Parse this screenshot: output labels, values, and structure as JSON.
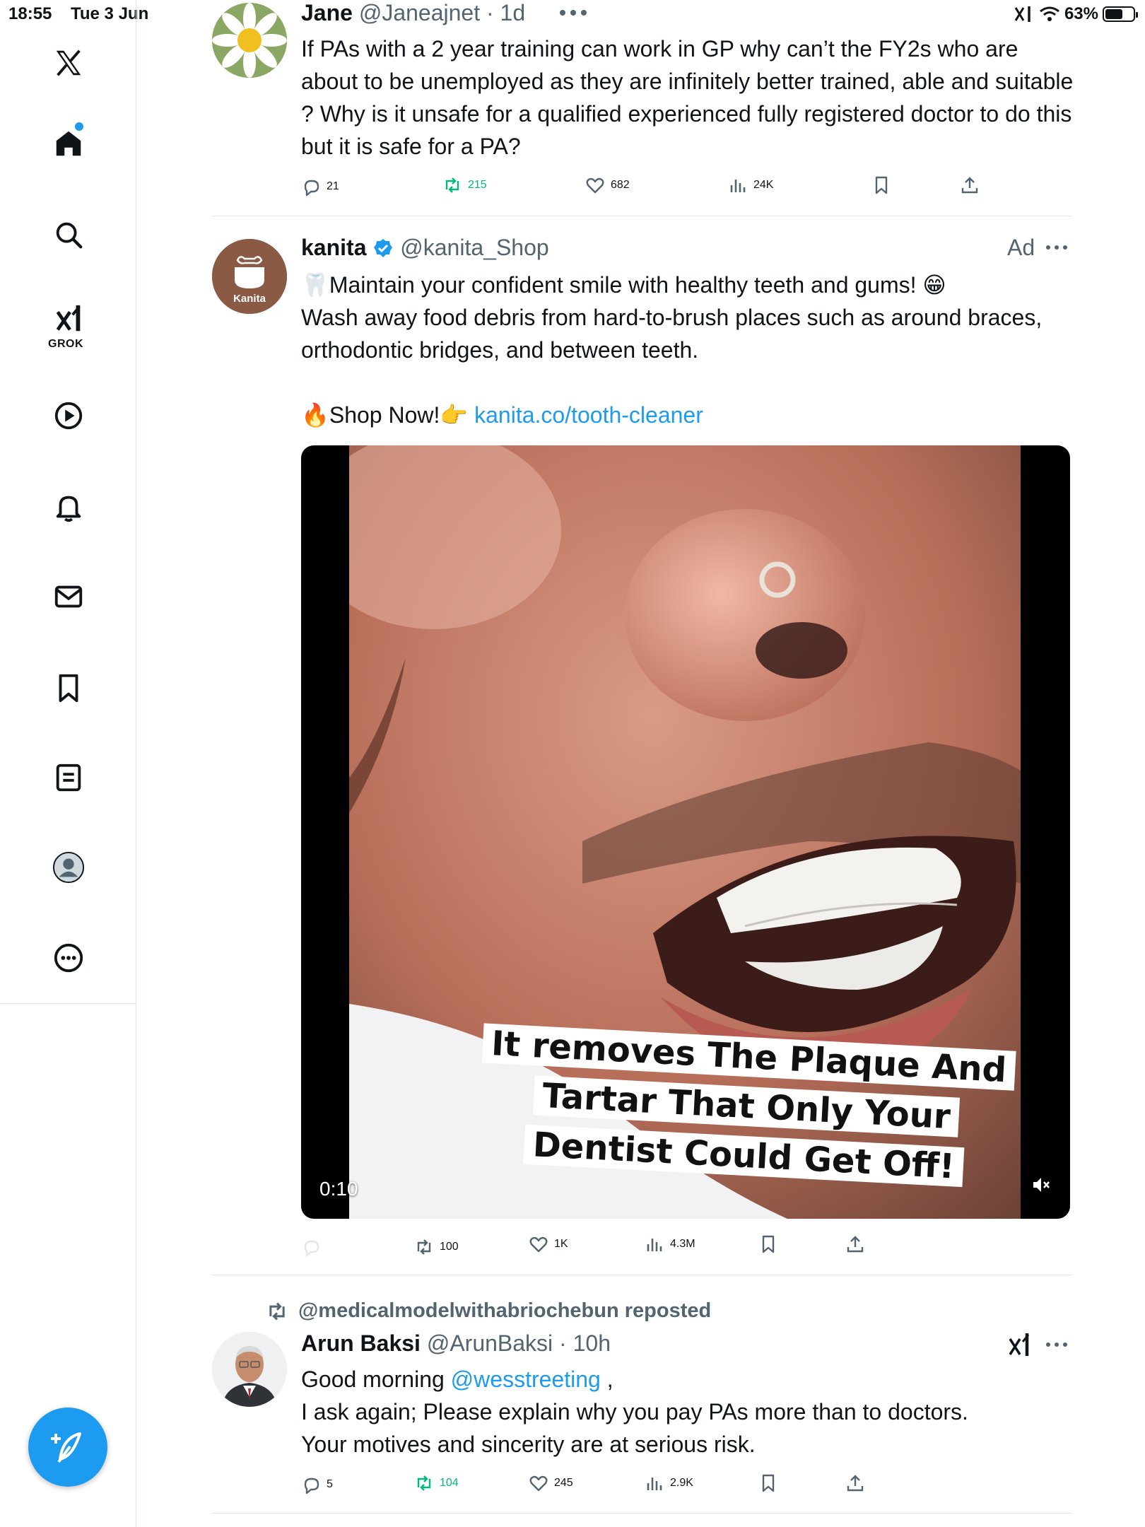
{
  "status_bar": {
    "time": "18:55",
    "date": "Tue 3 Jun",
    "battery": "63%",
    "battery_level": 0.63
  },
  "sidebar": {
    "grok_label": "GROK",
    "icons": [
      "x-logo-icon",
      "home-icon",
      "search-icon",
      "grok-icon",
      "video-icon",
      "notifications-icon",
      "messages-icon",
      "bookmarks-icon",
      "lists-icon",
      "profile-icon",
      "more-icon"
    ]
  },
  "posts": [
    {
      "name": "Jane",
      "handle": "@Janeajnet",
      "time": "· 1d",
      "body": "If PAs with a 2 year training can work in GP why can’t the FY2s who are about to be unemployed as they are infinitely better trained, able and suitable ? Why is it unsafe for a qualified experienced fully registered doctor to do this but it is safe for a PA?",
      "replies": "21",
      "reposts": "215",
      "likes": "682",
      "views": "24K"
    },
    {
      "name": "kanita",
      "handle": "@kanita_Shop",
      "ad_label": "Ad",
      "avatar_text": "Kanita",
      "line1": "🦷Maintain your confident smile with healthy teeth and gums! 😁",
      "line2": "Wash away food debris from hard-to-brush places such as around braces, orthodontic bridges, and between teeth.",
      "shop_text": "🔥Shop Now!👉 ",
      "link": "kanita.co/tooth-cleaner",
      "video_time": "0:10",
      "caption": "It removes The Plaque And Tartar That Only Your Dentist Could Get Off!",
      "reposts": "100",
      "likes": "1K",
      "views": "4.3M"
    },
    {
      "repost_by": "@medicalmodelwithabriochebun reposted",
      "name": "Arun Baksi",
      "handle": "@ArunBaksi",
      "time": "· 10h",
      "greeting": "Good morning ",
      "mention": "@wesstreeting",
      "greeting_end": " ,",
      "line2": "I ask again; Please explain why you pay PAs more than to doctors.",
      "line3": "Your motives and sincerity are at serious risk.",
      "replies": "5",
      "reposts": "104",
      "likes": "245",
      "views": "2.9K"
    }
  ],
  "colors": {
    "accent": "#1d9bf0",
    "repost_green": "#00ba7c",
    "muted": "#536471",
    "kanita_brown": "#8a5a44"
  }
}
